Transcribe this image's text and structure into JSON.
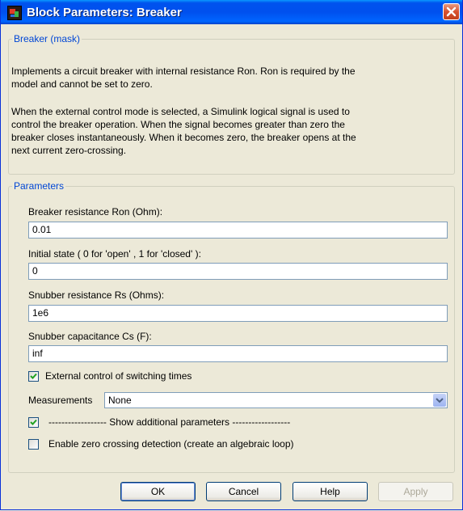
{
  "window": {
    "title": "Block Parameters: Breaker"
  },
  "mask": {
    "legend": "Breaker (mask)",
    "desc_lines_1": [
      "Implements a circuit breaker with internal resistance Ron. Ron is required by the",
      "model  and cannot be set to zero."
    ],
    "desc_lines_2": [
      "When the external control mode is selected, a Simulink  logical signal is used to",
      "control the breaker operation.  When  the signal becomes greater than zero the",
      "breaker closes instantaneously.  When it becomes zero, the breaker opens at the",
      "next current zero-crossing."
    ]
  },
  "parameters": {
    "legend": "Parameters",
    "fields": [
      {
        "label": "Breaker resistance Ron (Ohm):",
        "value": "0.01"
      },
      {
        "label": "Initial state ( 0 for 'open' , 1 for 'closed' ):",
        "value": "0"
      },
      {
        "label": "Snubber resistance Rs (Ohms):",
        "value": "1e6"
      },
      {
        "label": "Snubber capacitance Cs (F):",
        "value": "inf"
      }
    ],
    "external_control": {
      "label": "External control of switching times",
      "checked": true
    },
    "measurements": {
      "label": "Measurements",
      "value": "None"
    },
    "show_additional": {
      "label": "------------------ Show additional parameters ------------------",
      "checked": true
    },
    "zero_crossing": {
      "label": "Enable zero crossing detection (create an algebraic loop)",
      "checked": false
    }
  },
  "buttons": {
    "ok": "OK",
    "cancel": "Cancel",
    "help": "Help",
    "apply": "Apply"
  }
}
